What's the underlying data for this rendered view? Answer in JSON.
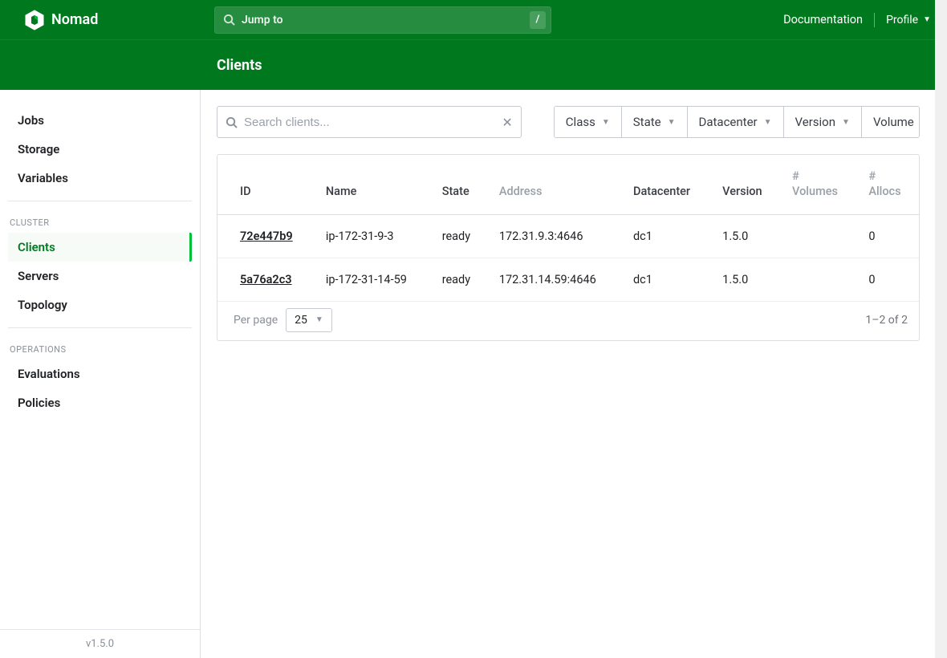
{
  "brand": {
    "name": "Nomad"
  },
  "topbar": {
    "jump_label": "Jump to",
    "jump_shortcut": "/",
    "doc_link": "Documentation",
    "profile_label": "Profile"
  },
  "subheader": {
    "title": "Clients"
  },
  "sidebar": {
    "top_items": [
      {
        "label": "Jobs"
      },
      {
        "label": "Storage"
      },
      {
        "label": "Variables"
      }
    ],
    "cluster_label": "CLUSTER",
    "cluster_items": [
      {
        "label": "Clients",
        "active": true
      },
      {
        "label": "Servers"
      },
      {
        "label": "Topology"
      }
    ],
    "operations_label": "OPERATIONS",
    "operations_items": [
      {
        "label": "Evaluations"
      },
      {
        "label": "Policies"
      }
    ],
    "version": "v1.5.0"
  },
  "toolbar": {
    "search_placeholder": "Search clients...",
    "filters": [
      {
        "label": "Class"
      },
      {
        "label": "State"
      },
      {
        "label": "Datacenter"
      },
      {
        "label": "Version"
      },
      {
        "label": "Volume"
      }
    ]
  },
  "table": {
    "headers": {
      "id": "ID",
      "name": "Name",
      "state": "State",
      "address": "Address",
      "datacenter": "Datacenter",
      "version": "Version",
      "volumes_l1": "#",
      "volumes_l2": "Volumes",
      "allocs_l1": "#",
      "allocs_l2": "Allocs"
    },
    "rows": [
      {
        "id": "72e447b9",
        "name": "ip-172-31-9-3",
        "state": "ready",
        "address": "172.31.9.3:4646",
        "datacenter": "dc1",
        "version": "1.5.0",
        "allocs": "0"
      },
      {
        "id": "5a76a2c3",
        "name": "ip-172-31-14-59",
        "state": "ready",
        "address": "172.31.14.59:4646",
        "datacenter": "dc1",
        "version": "1.5.0",
        "allocs": "0"
      }
    ],
    "per_page_label": "Per page",
    "per_page_value": "25",
    "page_count": "1–2 of 2"
  }
}
